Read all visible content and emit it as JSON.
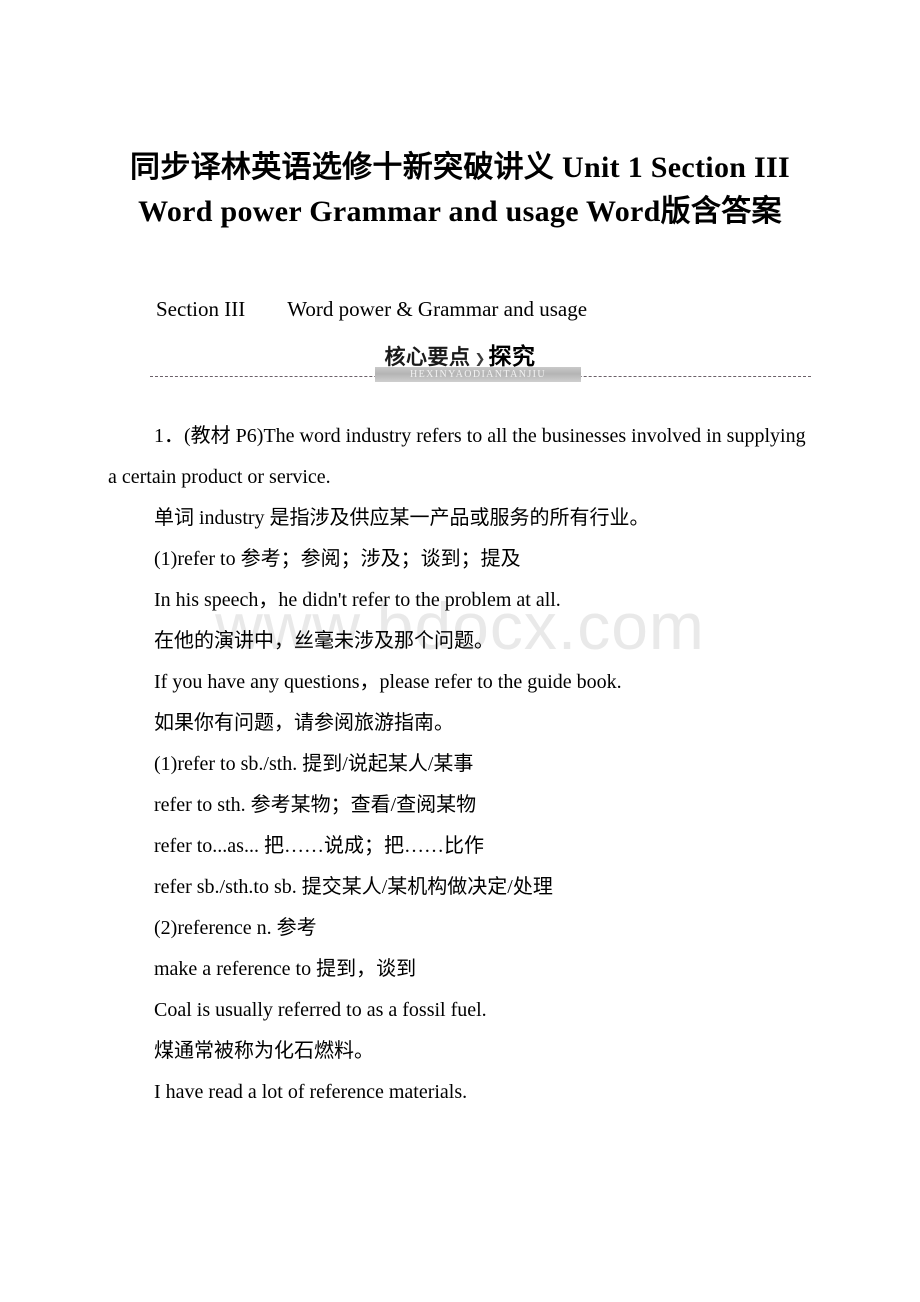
{
  "document": {
    "title": "同步译林英语选修十新突破讲义 Unit 1 Section III Word power Grammar and usage Word版含答案",
    "section_heading": "Section III　　Word power & Grammar and usage",
    "watermark": "www.bdocx.com"
  },
  "banner": {
    "label_left": "核心要点",
    "arrow": "❯",
    "label_right": "探究",
    "pinyin": "HEXINYAODIANTANJIU"
  },
  "content": {
    "lines": [
      {
        "id": "line-1",
        "style": "indent",
        "text": "1．(教材 P6)The word industry refers to all the businesses involved in supplying a certain product or service."
      },
      {
        "id": "line-2",
        "style": "hang",
        "text": "单词 industry 是指涉及供应某一产品或服务的所有行业。"
      },
      {
        "id": "line-3",
        "style": "hang",
        "text": "(1)refer to 参考；参阅；涉及；谈到；提及"
      },
      {
        "id": "line-4",
        "style": "hang",
        "text": "In his speech，he didn't refer to the problem at all."
      },
      {
        "id": "line-5",
        "style": "hang",
        "text": "在他的演讲中，丝毫未涉及那个问题。"
      },
      {
        "id": "line-6",
        "style": "hang",
        "text": "If you have any questions，please refer to the guide book."
      },
      {
        "id": "line-7",
        "style": "hang",
        "text": "如果你有问题，请参阅旅游指南。"
      },
      {
        "id": "line-8",
        "style": "hang",
        "text": "(1)refer to sb./sth. 提到/说起某人/某事"
      },
      {
        "id": "line-9",
        "style": "hang",
        "text": "refer to sth. 参考某物；查看/查阅某物"
      },
      {
        "id": "line-10",
        "style": "hang",
        "text": "refer to...as... 把……说成；把……比作"
      },
      {
        "id": "line-11",
        "style": "hang",
        "text": "refer sb./sth.to sb. 提交某人/某机构做决定/处理"
      },
      {
        "id": "line-12",
        "style": "hang",
        "text": "(2)reference n. 参考"
      },
      {
        "id": "line-13",
        "style": "hang",
        "text": "make a reference to 提到，谈到"
      },
      {
        "id": "line-14",
        "style": "hang",
        "text": "Coal is usually referred to as a fossil fuel."
      },
      {
        "id": "line-15",
        "style": "hang",
        "text": "煤通常被称为化石燃料。"
      },
      {
        "id": "line-16",
        "style": "hang",
        "text": "I have read a lot of reference materials."
      }
    ]
  }
}
